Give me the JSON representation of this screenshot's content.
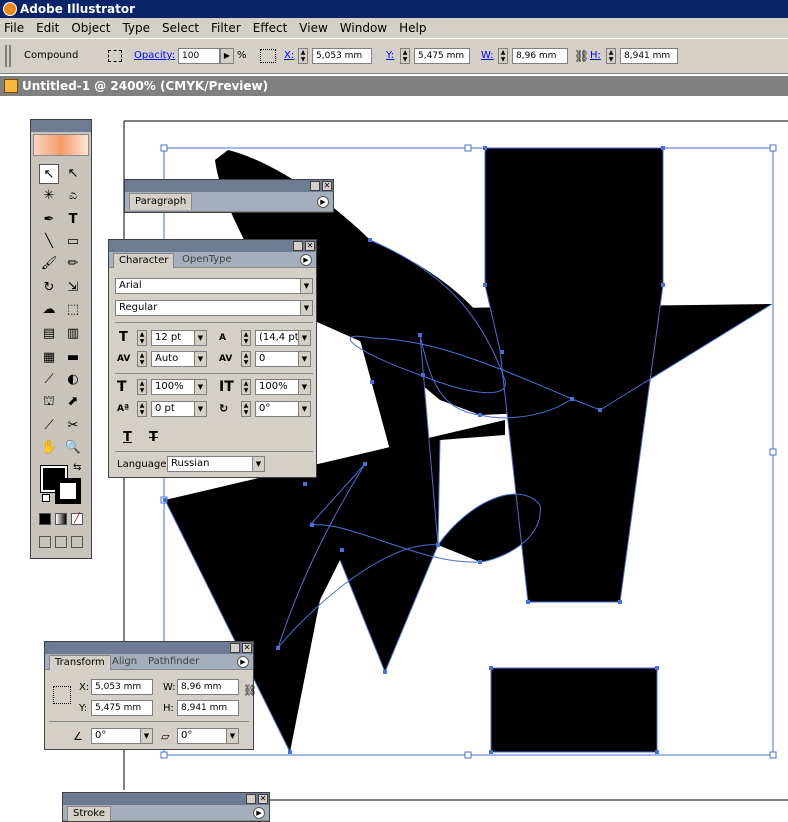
{
  "app": {
    "title": "Adobe Illustrator"
  },
  "menu": [
    "File",
    "Edit",
    "Object",
    "Type",
    "Select",
    "Filter",
    "Effect",
    "View",
    "Window",
    "Help"
  ],
  "control": {
    "selection": "Compound",
    "opacity_label": "Opacity:",
    "opacity": "100",
    "pct": "%",
    "x_label": "X:",
    "x": "5,053 mm",
    "y_label": "Y:",
    "y": "5,475 mm",
    "w_label": "W:",
    "w": "8,96 mm",
    "h_label": "H:",
    "h": "8,941 mm"
  },
  "document": {
    "title": "Untitled-1 @ 2400% (CMYK/Preview)"
  },
  "paragraph": {
    "tab": "Paragraph"
  },
  "character": {
    "tab": "Character",
    "tab2": "OpenType",
    "font": "Arial",
    "style": "Regular",
    "size": "12 pt",
    "leading": "(14,4 pt)",
    "kerning": "Auto",
    "tracking": "0",
    "vscale": "100%",
    "hscale": "100%",
    "baseline": "0 pt",
    "rotation": "0°",
    "language_label": "Language:",
    "language": "Russian"
  },
  "transform": {
    "tabs": [
      "Transform",
      "Align",
      "Pathfinder"
    ],
    "x_label": "X:",
    "x": "5,053 mm",
    "y_label": "Y:",
    "y": "5,475 mm",
    "w_label": "W:",
    "w": "8,96 mm",
    "h_label": "H:",
    "h": "8,941 mm",
    "angle": "0°",
    "shear": "0°"
  },
  "stroke": {
    "tab": "Stroke"
  },
  "colors": {
    "titlebar": "#0a246a",
    "chrome": "#d4d0c8",
    "panel_title": "#6d7c92",
    "path": "#4a6fd8"
  }
}
